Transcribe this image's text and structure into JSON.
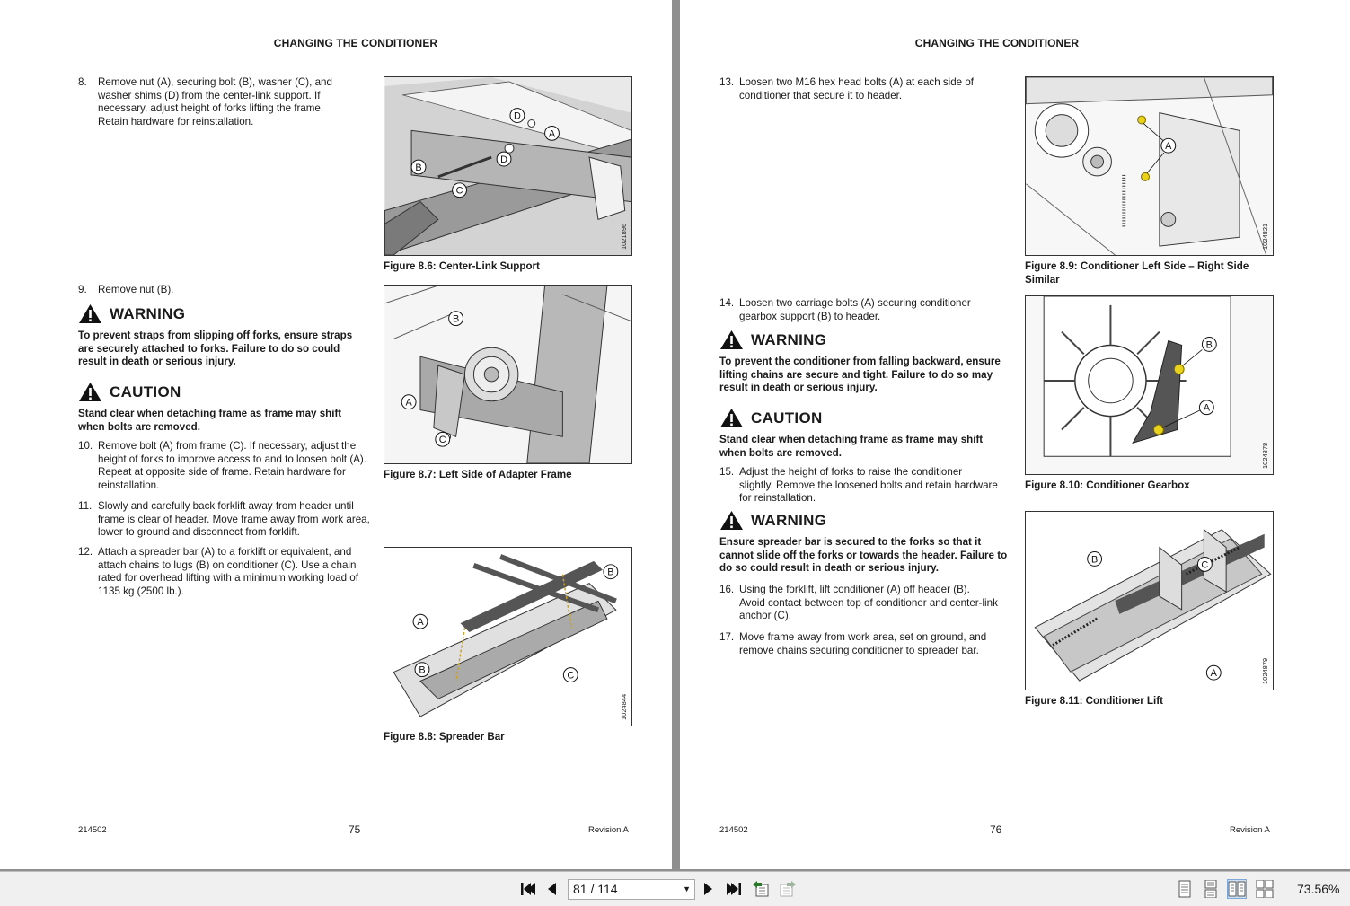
{
  "left_page": {
    "header": "CHANGING THE CONDITIONER",
    "step8": {
      "num": "8.",
      "text": "Remove nut (A), securing bolt (B), washer (C), and washer shims (D) from the center-link support. If necessary, adjust height of forks lifting the frame. Retain hardware for reinstallation."
    },
    "step9": {
      "num": "9.",
      "text": "Remove nut (B)."
    },
    "warning1": {
      "title": "WARNING",
      "text": "To prevent straps from slipping off forks, ensure straps are securely attached to forks. Failure to do so could result in death or serious injury."
    },
    "caution1": {
      "title": "CAUTION",
      "text": "Stand clear when detaching frame as frame may shift when bolts are removed."
    },
    "step10": {
      "num": "10.",
      "text": "Remove bolt (A) from frame (C). If necessary, adjust the height of forks to improve access to and to loosen bolt (A). Repeat at opposite side of frame. Retain hardware for reinstallation."
    },
    "step11": {
      "num": "11.",
      "text": "Slowly and carefully back forklift away from header until frame is clear of header. Move frame away from work area, lower to ground and disconnect from forklift."
    },
    "step12": {
      "num": "12.",
      "text": "Attach a spreader bar (A) to a forklift or equivalent, and attach chains to lugs (B) on conditioner (C). Use a chain rated for overhead lifting with a minimum working load of 1135 kg (2500 lb.)."
    },
    "fig86": {
      "caption": "Figure 8.6: Center-Link Support",
      "code": "1021896",
      "labels": [
        "D",
        "A",
        "D",
        "B",
        "C"
      ]
    },
    "fig87": {
      "caption": "Figure 8.7: Left Side of Adapter Frame",
      "labels": [
        "B",
        "A",
        "C"
      ]
    },
    "fig88": {
      "caption": "Figure 8.8: Spreader Bar",
      "code": "1024844",
      "labels": [
        "B",
        "A",
        "B",
        "C"
      ]
    },
    "footer_left": "214502",
    "page_number": "75",
    "footer_right": "Revision  A"
  },
  "right_page": {
    "header": "CHANGING THE CONDITIONER",
    "step13": {
      "num": "13.",
      "text": "Loosen two M16 hex head bolts (A) at each side of conditioner that secure it to header."
    },
    "step14": {
      "num": "14.",
      "text": "Loosen two carriage bolts (A) securing conditioner gearbox support (B) to header."
    },
    "warning2": {
      "title": "WARNING",
      "text": "To prevent the conditioner from falling backward, ensure lifting chains are secure and tight. Failure to do so may result in death or serious injury."
    },
    "caution2": {
      "title": "CAUTION",
      "text": "Stand clear when detaching frame as frame may shift when bolts are removed."
    },
    "step15": {
      "num": "15.",
      "text": "Adjust the height of forks to raise the conditioner slightly. Remove the loosened bolts and retain hardware for reinstallation."
    },
    "warning3": {
      "title": "WARNING",
      "text": "Ensure spreader bar is secured to the forks so that it cannot slide off the forks or towards the header. Failure to do so could result in death or serious injury."
    },
    "step16": {
      "num": "16.",
      "text": "Using the forklift, lift conditioner (A) off header (B). Avoid contact between top of conditioner and center-link anchor (C)."
    },
    "step17": {
      "num": "17.",
      "text": "Move frame away from work area, set on ground, and remove chains securing conditioner to spreader bar."
    },
    "fig89": {
      "caption": "Figure 8.9: Conditioner Left Side – Right Side Similar",
      "code": "1024821",
      "labels": [
        "A"
      ]
    },
    "fig810": {
      "caption": "Figure 8.10: Conditioner Gearbox",
      "code": "1024878",
      "labels": [
        "B",
        "A"
      ]
    },
    "fig811": {
      "caption": "Figure 8.11: Conditioner Lift",
      "code": "1024879",
      "labels": [
        "B",
        "C",
        "A"
      ]
    },
    "footer_left": "214502",
    "page_number": "76",
    "footer_right": "Revision  A"
  },
  "toolbar": {
    "page_indicator": "81 / 114",
    "zoom": "73.56%"
  },
  "colors": {
    "bolt_highlight": "#e8d21a",
    "viewer_bg": "#8f8f8f",
    "toolbar_bg": "#f0f0f0"
  }
}
